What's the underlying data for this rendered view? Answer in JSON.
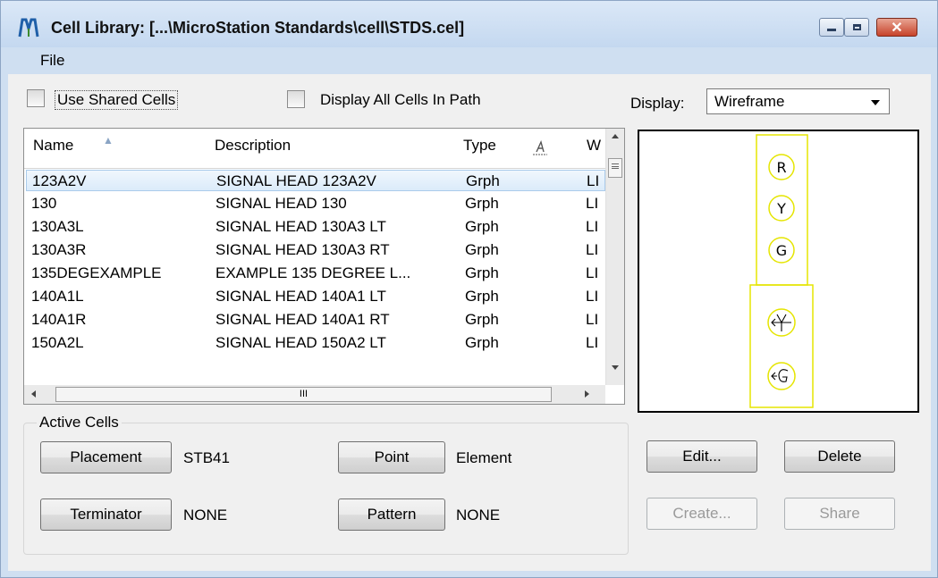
{
  "window": {
    "title": "Cell Library: [...\\MicroStation Standards\\cell\\STDS.cel]",
    "min_label": "▁",
    "max_label": "□",
    "close_label": "✕"
  },
  "menu": {
    "file": "File"
  },
  "options": {
    "use_shared_cells": "Use Shared Cells",
    "display_all_cells": "Display All Cells In Path",
    "display_label": "Display:",
    "display_value": "Wireframe"
  },
  "table": {
    "columns": [
      "Name",
      "Description",
      "Type",
      "𝐴",
      "W"
    ],
    "rows": [
      {
        "name": "123A2V",
        "description": "SIGNAL HEAD 123A2V",
        "type": "Grph",
        "w": "LI"
      },
      {
        "name": "130",
        "description": "SIGNAL HEAD 130",
        "type": "Grph",
        "w": "LI"
      },
      {
        "name": "130A3L",
        "description": "SIGNAL HEAD 130A3 LT",
        "type": "Grph",
        "w": "LI"
      },
      {
        "name": "130A3R",
        "description": "SIGNAL HEAD 130A3 RT",
        "type": "Grph",
        "w": "LI"
      },
      {
        "name": "135DEGEXAMPLE",
        "description": "EXAMPLE 135 DEGREE L...",
        "type": "Grph",
        "w": "LI"
      },
      {
        "name": "140A1L",
        "description": "SIGNAL HEAD 140A1 LT",
        "type": "Grph",
        "w": "LI"
      },
      {
        "name": "140A1R",
        "description": "SIGNAL HEAD 140A1 RT",
        "type": "Grph",
        "w": "LI"
      },
      {
        "name": "150A2L",
        "description": "SIGNAL HEAD 150A2 LT",
        "type": "Grph",
        "w": "LI"
      }
    ],
    "hscroll_grip": "III"
  },
  "preview": {
    "labels": [
      "R",
      "Y",
      "G"
    ]
  },
  "active_cells": {
    "title": "Active Cells",
    "placement_button": "Placement",
    "placement_value": "STB41",
    "point_button": "Point",
    "point_value": "Element",
    "terminator_button": "Terminator",
    "terminator_value": "NONE",
    "pattern_button": "Pattern",
    "pattern_value": "NONE"
  },
  "actions": {
    "edit": "Edit...",
    "delete": "Delete",
    "create": "Create...",
    "share": "Share"
  },
  "colors": {
    "preview_stroke": "#ffff00",
    "selection": "#dbebfa"
  }
}
